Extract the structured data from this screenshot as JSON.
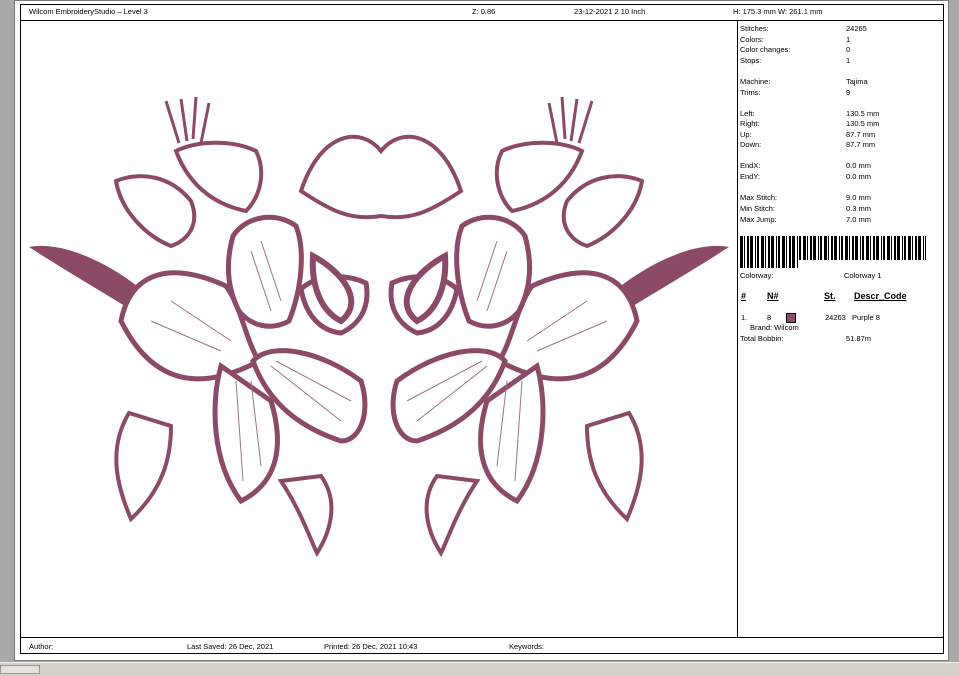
{
  "header": {
    "app_title": "Wilcom EmbroideryStudio – Level 3",
    "zoom": "Z: 0.86",
    "date_info": "23-12-2021 2 10 Inch",
    "size": "H: 175.3 mm   W: 261.1 mm"
  },
  "stats": [
    {
      "label": "Stitches:",
      "value": "24265"
    },
    {
      "label": "Colors:",
      "value": "1"
    },
    {
      "label": "Color changes:",
      "value": "0"
    },
    {
      "label": "Stops:",
      "value": "1"
    },
    {
      "label": "Machine:",
      "value": "Tajima"
    },
    {
      "label": "Trims:",
      "value": "9"
    },
    {
      "label": "Left:",
      "value": "130.5 mm"
    },
    {
      "label": "Right:",
      "value": "130.5 mm"
    },
    {
      "label": "Up:",
      "value": "87.7 mm"
    },
    {
      "label": "Down:",
      "value": "87.7 mm"
    },
    {
      "label": "EndX:",
      "value": "0.0 mm"
    },
    {
      "label": "EndY:",
      "value": "0.0 mm"
    },
    {
      "label": "Max Stitch:",
      "value": "9.0 mm"
    },
    {
      "label": "Min Stitch:",
      "value": "0.3 mm"
    },
    {
      "label": "Max Jump:",
      "value": "7.0 mm"
    }
  ],
  "colorway": {
    "label": "Colorway:",
    "value": "Colorway 1"
  },
  "table": {
    "headers": {
      "num": "#",
      "n": "N#",
      "st": "St.",
      "descr": "Descr_Code"
    },
    "row": {
      "index": "1.",
      "n": "8",
      "st": "24263",
      "descr": "Purple 8",
      "brand": "Brand: Wilcom",
      "swatch_color": "#8b4a68"
    }
  },
  "bobbin": {
    "label": "Total Bobbin:",
    "value": "51.87m"
  },
  "footer": {
    "author": "Author:",
    "last_saved": "Last Saved: 26 Dec, 2021",
    "printed": "Printed: 26 Dec, 2021 10:43",
    "keywords": "Keywords:"
  },
  "design": {
    "thread_color": "#8b4a68",
    "stitch_color": "#a07086"
  }
}
